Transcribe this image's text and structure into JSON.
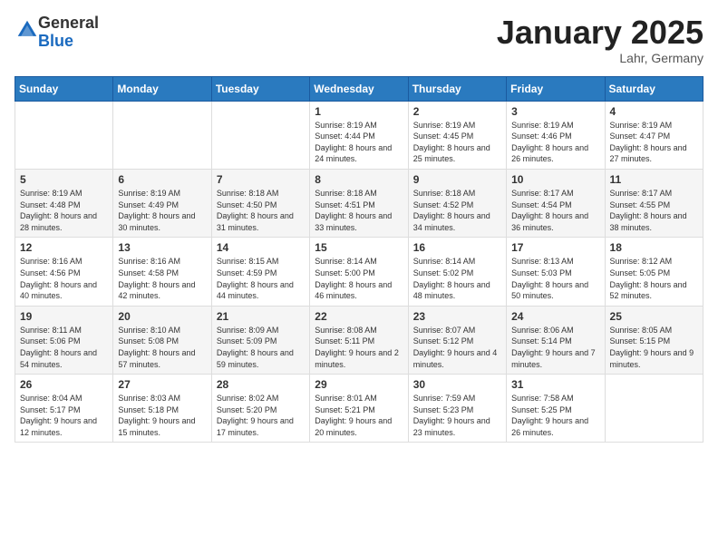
{
  "logo": {
    "general": "General",
    "blue": "Blue"
  },
  "header": {
    "month": "January 2025",
    "location": "Lahr, Germany"
  },
  "weekdays": [
    "Sunday",
    "Monday",
    "Tuesday",
    "Wednesday",
    "Thursday",
    "Friday",
    "Saturday"
  ],
  "weeks": [
    [
      {
        "day": "",
        "sunrise": "",
        "sunset": "",
        "daylight": ""
      },
      {
        "day": "",
        "sunrise": "",
        "sunset": "",
        "daylight": ""
      },
      {
        "day": "",
        "sunrise": "",
        "sunset": "",
        "daylight": ""
      },
      {
        "day": "1",
        "sunrise": "Sunrise: 8:19 AM",
        "sunset": "Sunset: 4:44 PM",
        "daylight": "Daylight: 8 hours and 24 minutes."
      },
      {
        "day": "2",
        "sunrise": "Sunrise: 8:19 AM",
        "sunset": "Sunset: 4:45 PM",
        "daylight": "Daylight: 8 hours and 25 minutes."
      },
      {
        "day": "3",
        "sunrise": "Sunrise: 8:19 AM",
        "sunset": "Sunset: 4:46 PM",
        "daylight": "Daylight: 8 hours and 26 minutes."
      },
      {
        "day": "4",
        "sunrise": "Sunrise: 8:19 AM",
        "sunset": "Sunset: 4:47 PM",
        "daylight": "Daylight: 8 hours and 27 minutes."
      }
    ],
    [
      {
        "day": "5",
        "sunrise": "Sunrise: 8:19 AM",
        "sunset": "Sunset: 4:48 PM",
        "daylight": "Daylight: 8 hours and 28 minutes."
      },
      {
        "day": "6",
        "sunrise": "Sunrise: 8:19 AM",
        "sunset": "Sunset: 4:49 PM",
        "daylight": "Daylight: 8 hours and 30 minutes."
      },
      {
        "day": "7",
        "sunrise": "Sunrise: 8:18 AM",
        "sunset": "Sunset: 4:50 PM",
        "daylight": "Daylight: 8 hours and 31 minutes."
      },
      {
        "day": "8",
        "sunrise": "Sunrise: 8:18 AM",
        "sunset": "Sunset: 4:51 PM",
        "daylight": "Daylight: 8 hours and 33 minutes."
      },
      {
        "day": "9",
        "sunrise": "Sunrise: 8:18 AM",
        "sunset": "Sunset: 4:52 PM",
        "daylight": "Daylight: 8 hours and 34 minutes."
      },
      {
        "day": "10",
        "sunrise": "Sunrise: 8:17 AM",
        "sunset": "Sunset: 4:54 PM",
        "daylight": "Daylight: 8 hours and 36 minutes."
      },
      {
        "day": "11",
        "sunrise": "Sunrise: 8:17 AM",
        "sunset": "Sunset: 4:55 PM",
        "daylight": "Daylight: 8 hours and 38 minutes."
      }
    ],
    [
      {
        "day": "12",
        "sunrise": "Sunrise: 8:16 AM",
        "sunset": "Sunset: 4:56 PM",
        "daylight": "Daylight: 8 hours and 40 minutes."
      },
      {
        "day": "13",
        "sunrise": "Sunrise: 8:16 AM",
        "sunset": "Sunset: 4:58 PM",
        "daylight": "Daylight: 8 hours and 42 minutes."
      },
      {
        "day": "14",
        "sunrise": "Sunrise: 8:15 AM",
        "sunset": "Sunset: 4:59 PM",
        "daylight": "Daylight: 8 hours and 44 minutes."
      },
      {
        "day": "15",
        "sunrise": "Sunrise: 8:14 AM",
        "sunset": "Sunset: 5:00 PM",
        "daylight": "Daylight: 8 hours and 46 minutes."
      },
      {
        "day": "16",
        "sunrise": "Sunrise: 8:14 AM",
        "sunset": "Sunset: 5:02 PM",
        "daylight": "Daylight: 8 hours and 48 minutes."
      },
      {
        "day": "17",
        "sunrise": "Sunrise: 8:13 AM",
        "sunset": "Sunset: 5:03 PM",
        "daylight": "Daylight: 8 hours and 50 minutes."
      },
      {
        "day": "18",
        "sunrise": "Sunrise: 8:12 AM",
        "sunset": "Sunset: 5:05 PM",
        "daylight": "Daylight: 8 hours and 52 minutes."
      }
    ],
    [
      {
        "day": "19",
        "sunrise": "Sunrise: 8:11 AM",
        "sunset": "Sunset: 5:06 PM",
        "daylight": "Daylight: 8 hours and 54 minutes."
      },
      {
        "day": "20",
        "sunrise": "Sunrise: 8:10 AM",
        "sunset": "Sunset: 5:08 PM",
        "daylight": "Daylight: 8 hours and 57 minutes."
      },
      {
        "day": "21",
        "sunrise": "Sunrise: 8:09 AM",
        "sunset": "Sunset: 5:09 PM",
        "daylight": "Daylight: 8 hours and 59 minutes."
      },
      {
        "day": "22",
        "sunrise": "Sunrise: 8:08 AM",
        "sunset": "Sunset: 5:11 PM",
        "daylight": "Daylight: 9 hours and 2 minutes."
      },
      {
        "day": "23",
        "sunrise": "Sunrise: 8:07 AM",
        "sunset": "Sunset: 5:12 PM",
        "daylight": "Daylight: 9 hours and 4 minutes."
      },
      {
        "day": "24",
        "sunrise": "Sunrise: 8:06 AM",
        "sunset": "Sunset: 5:14 PM",
        "daylight": "Daylight: 9 hours and 7 minutes."
      },
      {
        "day": "25",
        "sunrise": "Sunrise: 8:05 AM",
        "sunset": "Sunset: 5:15 PM",
        "daylight": "Daylight: 9 hours and 9 minutes."
      }
    ],
    [
      {
        "day": "26",
        "sunrise": "Sunrise: 8:04 AM",
        "sunset": "Sunset: 5:17 PM",
        "daylight": "Daylight: 9 hours and 12 minutes."
      },
      {
        "day": "27",
        "sunrise": "Sunrise: 8:03 AM",
        "sunset": "Sunset: 5:18 PM",
        "daylight": "Daylight: 9 hours and 15 minutes."
      },
      {
        "day": "28",
        "sunrise": "Sunrise: 8:02 AM",
        "sunset": "Sunset: 5:20 PM",
        "daylight": "Daylight: 9 hours and 17 minutes."
      },
      {
        "day": "29",
        "sunrise": "Sunrise: 8:01 AM",
        "sunset": "Sunset: 5:21 PM",
        "daylight": "Daylight: 9 hours and 20 minutes."
      },
      {
        "day": "30",
        "sunrise": "Sunrise: 7:59 AM",
        "sunset": "Sunset: 5:23 PM",
        "daylight": "Daylight: 9 hours and 23 minutes."
      },
      {
        "day": "31",
        "sunrise": "Sunrise: 7:58 AM",
        "sunset": "Sunset: 5:25 PM",
        "daylight": "Daylight: 9 hours and 26 minutes."
      },
      {
        "day": "",
        "sunrise": "",
        "sunset": "",
        "daylight": ""
      }
    ]
  ]
}
